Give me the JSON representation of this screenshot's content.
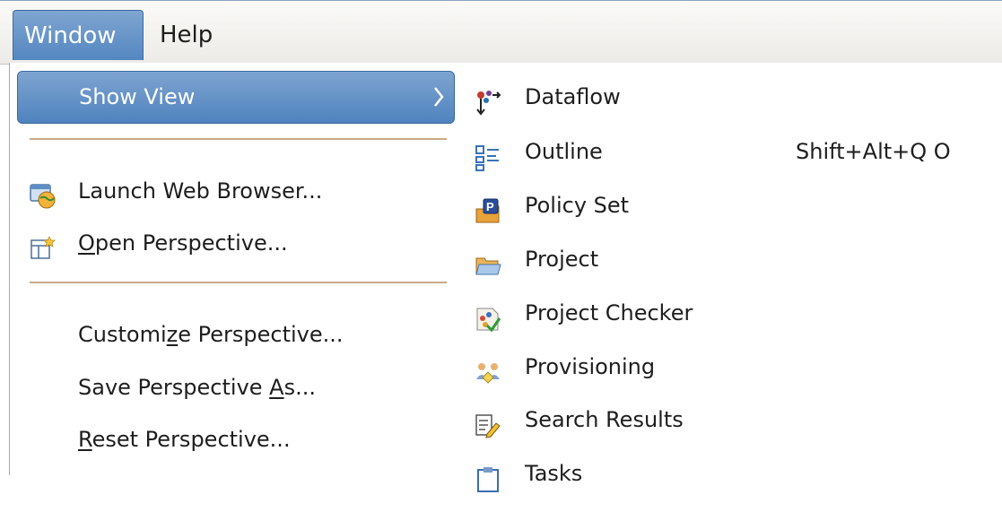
{
  "menubar": {
    "window_label": "Window",
    "help_label": "Help"
  },
  "window_menu": {
    "show_view": "Show View",
    "launch_browser": "Launch Web Browser...",
    "open_perspective": {
      "u": "O",
      "rest": "pen Perspective..."
    },
    "customize_perspective": {
      "pre": "Customi",
      "u": "z",
      "post": "e Perspective..."
    },
    "save_perspective": {
      "pre": "Save Perspective ",
      "u": "A",
      "post": "s..."
    },
    "reset_perspective": {
      "u": "R",
      "rest": "eset Perspective..."
    }
  },
  "show_view_menu": {
    "items": [
      {
        "label": "Dataflow",
        "shortcut": "",
        "icon": "dataflow-icon"
      },
      {
        "label": "Outline",
        "shortcut": "Shift+Alt+Q O",
        "icon": "outline-icon"
      },
      {
        "label": "Policy Set",
        "shortcut": "",
        "icon": "policy-set-icon"
      },
      {
        "label": "Project",
        "shortcut": "",
        "icon": "folder-icon"
      },
      {
        "label": "Project Checker",
        "shortcut": "",
        "icon": "project-checker-icon"
      },
      {
        "label": "Provisioning",
        "shortcut": "",
        "icon": "provisioning-icon"
      },
      {
        "label": "Search Results",
        "shortcut": "",
        "icon": "search-results-icon"
      },
      {
        "label": "Tasks",
        "shortcut": "",
        "icon": "tasks-icon"
      }
    ]
  },
  "colors": {
    "highlight": "#5a8cc5",
    "separator": "#c9a98a"
  }
}
